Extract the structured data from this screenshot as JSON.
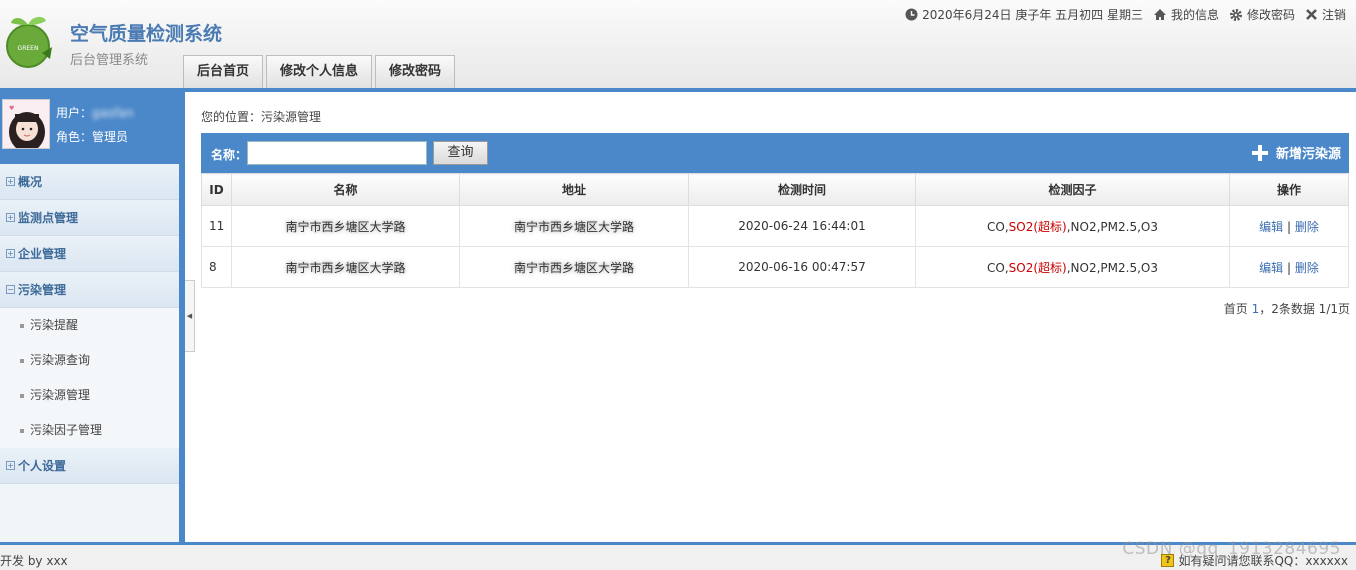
{
  "header": {
    "app_title": "空气质量检测系统",
    "app_subtitle": "后台管理系统",
    "logo_text": "GREEN",
    "date_text": "2020年6月24日 庚子年 五月初四 星期三",
    "my_info": "我的信息",
    "change_password": "修改密码",
    "logout": "注销"
  },
  "tabs": [
    "后台首页",
    "修改个人信息",
    "修改密码"
  ],
  "user": {
    "user_label": "用户：",
    "user_name": "gaofan",
    "role_label": "角色：",
    "role": "管理员"
  },
  "menu": {
    "overview": "概况",
    "monitor_points": "监测点管理",
    "enterprise": "企业管理",
    "pollution": "污染管理",
    "sub": [
      "污染提醒",
      "污染源查询",
      "污染源管理",
      "污染因子管理"
    ],
    "personal": "个人设置"
  },
  "breadcrumb": "您的位置：污染源管理",
  "search": {
    "label": "名称：",
    "value": "",
    "button": "查询",
    "add_button": "新增污染源"
  },
  "table": {
    "headers": [
      "ID",
      "名称",
      "地址",
      "检测时间",
      "检测因子",
      "操作"
    ],
    "rows": [
      {
        "id": "11",
        "name": "南宁市西乡塘区大学路",
        "address": "南宁市西乡塘区大学路",
        "time": "2020-06-24 16:44:01",
        "factor_pre": "CO,",
        "factor_alert": "SO2(超标)",
        "factor_post": ",NO2,PM2.5,O3",
        "edit": "编辑",
        "sep": "|",
        "delete": "删除"
      },
      {
        "id": "8",
        "name": "南宁市西乡塘区大学路",
        "address": "南宁市西乡塘区大学路",
        "time": "2020-06-16 00:47:57",
        "factor_pre": "CO,",
        "factor_alert": "SO2(超标)",
        "factor_post": ",NO2,PM2.5,O3",
        "edit": "编辑",
        "sep": "|",
        "delete": "删除"
      }
    ]
  },
  "pager": {
    "first": "首页",
    "current": "1",
    "summary": "，2条数据 1/1页"
  },
  "footer": {
    "left": "开发 by xxx",
    "right": "如有疑问请您联系QQ：xxxxxx"
  },
  "watermark": "CSDN @qq_1913284695",
  "colors": {
    "accent": "#4b88c9",
    "title": "#4a7bb3",
    "alert": "#cc0000",
    "link": "#3b6eb0"
  }
}
